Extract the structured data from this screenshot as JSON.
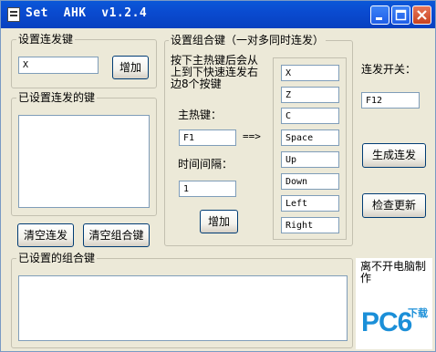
{
  "window": {
    "title": "Set  AHK  v1.2.4"
  },
  "trigger_group": {
    "legend": "设置连发键",
    "key_value": "X",
    "add_label": "增加"
  },
  "set_keys_group": {
    "legend": "已设置连发的键"
  },
  "clear_repeat_label": "清空连发",
  "clear_combo_label": "清空组合键",
  "combo_group": {
    "legend": "设置组合键（一对多同时连发）",
    "instruction": "按下主热键后会从上到下快速连发右边8个按键",
    "main_key_label": "主热键：",
    "main_key_value": "F1",
    "arrow": "==>",
    "interval_label": "时间间隔：",
    "interval_value": "1",
    "add_label": "增加",
    "keys": [
      "X",
      "Z",
      "C",
      "Space",
      "Up",
      "Down",
      "Left",
      "Right"
    ]
  },
  "toggle": {
    "label": "连发开关：",
    "value": "F12"
  },
  "generate_label": "生成连发",
  "update_label": "检查更新",
  "combo_list_group": {
    "legend": "已设置的组合键"
  },
  "note": "离不开电脑制作",
  "watermark": {
    "text": "PC6",
    "sub": "下载"
  }
}
